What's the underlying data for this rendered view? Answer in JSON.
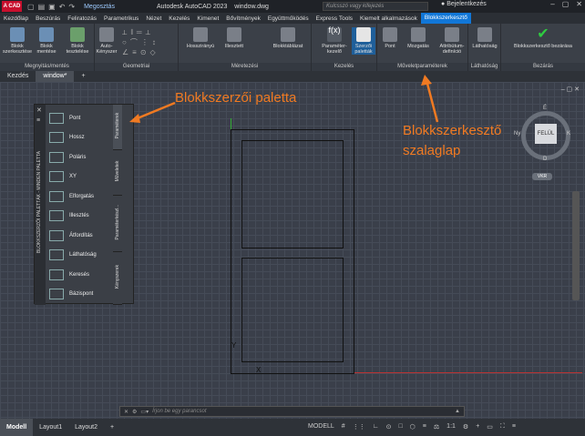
{
  "title": {
    "share": "Megosztás",
    "app": "Autodesk AutoCAD 2023",
    "file": "window.dwg",
    "search_placeholder": "Kulcsszó vagy kifejezés",
    "login": "Bejelentkezés"
  },
  "menu": [
    "Kezdőlap",
    "Beszúrás",
    "Feliratozás",
    "Parametrikus",
    "Nézet",
    "Kezelés",
    "Kimenet",
    "Bővítmények",
    "Együttműködés",
    "Express Tools",
    "Kiemelt alkalmazások",
    "Blokkszerkesztő"
  ],
  "ribbon": {
    "groups": [
      "Megnyitás/mentés",
      "Geometriai",
      "Méretezési",
      "Kezelés",
      "Műveletparaméterek",
      "Láthatóság",
      "Bezárás"
    ],
    "tools": [
      "Blokk szerkesztése",
      "Blokk mentése",
      "Blokk tesztelése",
      "Auto-Kényszer",
      "Hosszirányú",
      "Illesztett",
      "Blokktáblázat",
      "Paraméter-kezelő",
      "Szerzői paletták",
      "Pont",
      "Mozgatás",
      "Attribútum-definíció",
      "Láthatóság",
      "Blokkszerkesztő bezárása"
    ]
  },
  "filetabs": [
    "Kezdés",
    "window*"
  ],
  "palette": {
    "title": "BLOKKSZERZŐI PALETTÁK - MINDEN PALETTA",
    "items": [
      "Pont",
      "Hossz",
      "Poláris",
      "XY",
      "Elforgatás",
      "Illesztés",
      "Átfordítás",
      "Láthatóság",
      "Keresés",
      "Bázispont"
    ],
    "tabs": [
      "Paraméterek",
      "Műveletek",
      "Paraméterkészl...",
      "Kényszerek"
    ]
  },
  "annotations": {
    "palette": "Blokkszerzői paletta",
    "ribbon_line1": "Blokkszerkesztő",
    "ribbon_line2": "szalaglap"
  },
  "viewcube": {
    "face": "FELÜL",
    "n": "É",
    "s": "D",
    "e": "K",
    "w": "Ny",
    "wcs": "VKR"
  },
  "axis": {
    "y": "Y",
    "x": "X"
  },
  "command": {
    "placeholder": "Írjon be egy parancsot"
  },
  "status": {
    "tabs": [
      "Modell",
      "Layout1",
      "Layout2"
    ],
    "mode": "MODELL",
    "scale": "1:1"
  }
}
